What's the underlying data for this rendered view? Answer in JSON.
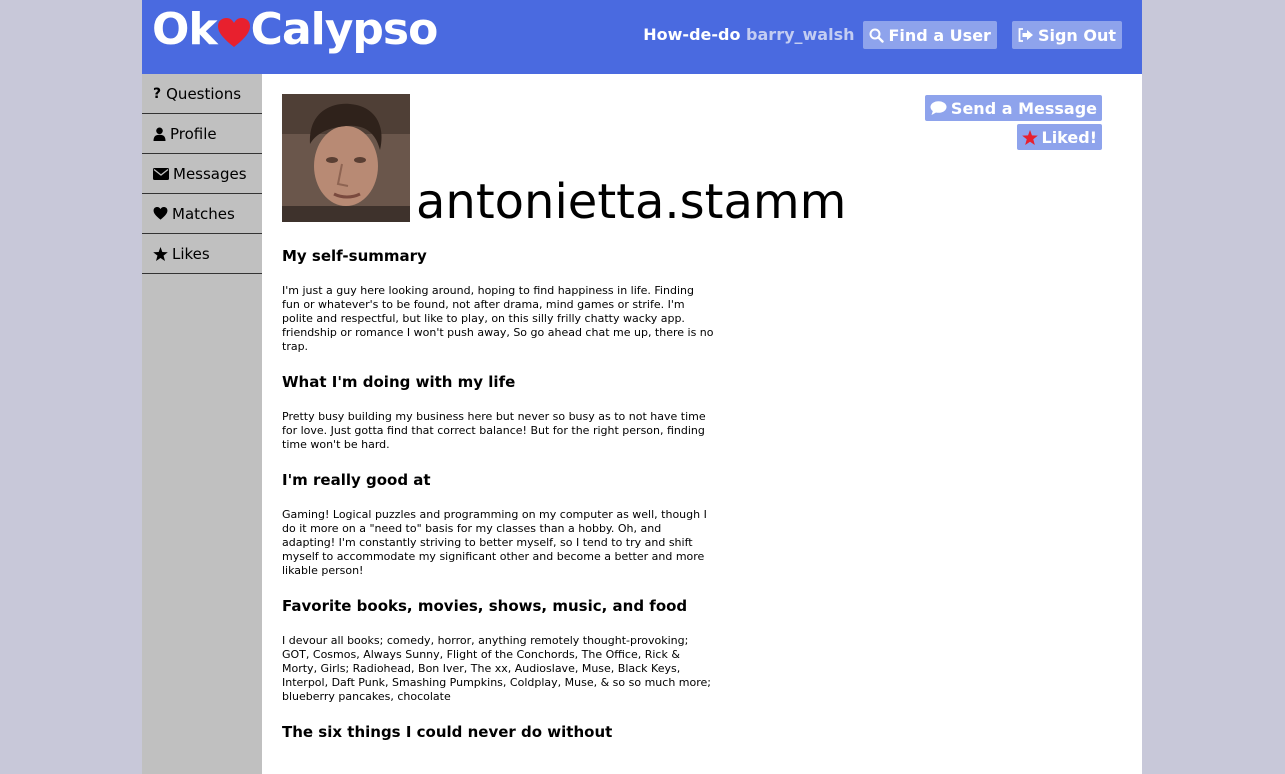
{
  "header": {
    "logo_left": "Ok",
    "logo_right": "Calypso",
    "greeting": "How-de-do",
    "username": "barry_walsh",
    "find_label": "Find a User",
    "signout_label": "Sign Out",
    "colors": {
      "bar": "#4a6ae0",
      "button": "#8ea3ec",
      "heart": "#e8202e"
    }
  },
  "sidebar": {
    "items": [
      {
        "label": "Questions",
        "icon": "question-icon"
      },
      {
        "label": "Profile",
        "icon": "user-icon"
      },
      {
        "label": "Messages",
        "icon": "envelope-icon"
      },
      {
        "label": "Matches",
        "icon": "heart-icon"
      },
      {
        "label": "Likes",
        "icon": "star-icon"
      }
    ]
  },
  "profile": {
    "username": "antonietta.stamm",
    "send_message_label": "Send a Message",
    "liked_label": "Liked!",
    "sections": [
      {
        "title": "My self-summary",
        "body": "I'm just a guy here looking around, hoping to find happiness in life. Finding fun or whatever's to be found, not after drama, mind games or strife. I'm polite and respectful, but like to play, on this silly frilly chatty wacky app. friendship or romance I won't push away, So go ahead chat me up, there is no trap."
      },
      {
        "title": "What I'm doing with my life",
        "body": "Pretty busy building my business here but never so busy as to not have time for love. Just gotta find that correct balance! But for the right person, finding time won't be hard."
      },
      {
        "title": "I'm really good at",
        "body": "Gaming! Logical puzzles and programming on my computer as well, though I do it more on a \"need to\" basis for my classes than a hobby. Oh, and adapting! I'm constantly striving to better myself, so I tend to try and shift myself to accommodate my significant other and become a better and more likable person!"
      },
      {
        "title": "Favorite books, movies, shows, music, and food",
        "body": "I devour all books; comedy, horror, anything remotely thought-provoking; GOT, Cosmos, Always Sunny, Flight of the Conchords, The Office, Rick & Morty, Girls; Radiohead, Bon Iver, The xx, Audioslave, Muse, Black Keys, Interpol, Daft Punk, Smashing Pumpkins, Coldplay, Muse, & so so much more; blueberry pancakes, chocolate"
      },
      {
        "title": "The six things I could never do without",
        "body": ""
      }
    ]
  }
}
